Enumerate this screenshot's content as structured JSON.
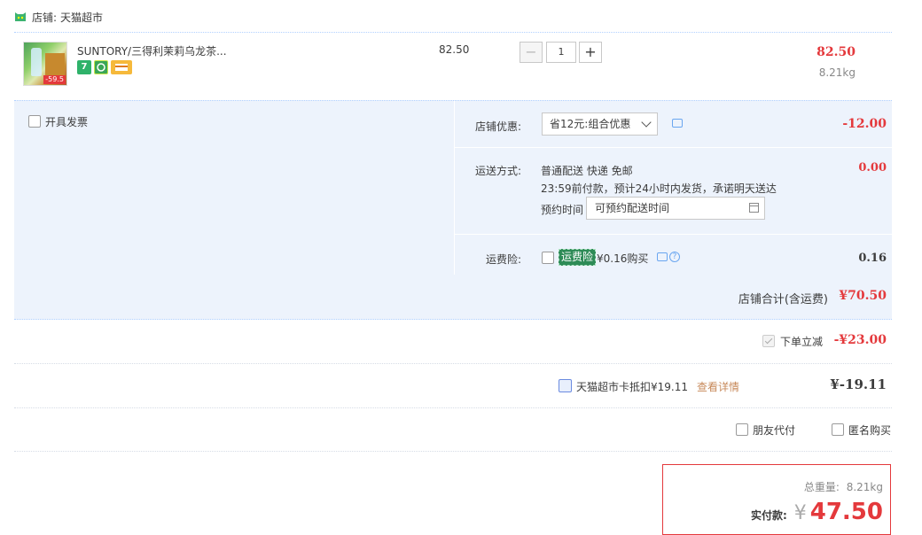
{
  "shop": {
    "label": "店铺:",
    "name": "天猫超市"
  },
  "item": {
    "title": "SUNTORY/三得利茉莉乌龙茶...",
    "image_price_tag": "-59.5",
    "badge_1": "7",
    "unit_price": "82.50",
    "quantity": "1",
    "minus_label": "−",
    "plus_label": "+",
    "total": "82.50",
    "weight": "8.21kg"
  },
  "invoice": {
    "label": "开具发票"
  },
  "shop_discount": {
    "label": "店铺优惠:",
    "selected": "省12元:组合优惠",
    "amount": "-12.00"
  },
  "shipping": {
    "label": "运送方式:",
    "line1": "普通配送 快递 免邮",
    "line2": "23:59前付款，预计24小时内发货，承诺明天送达",
    "schedule_label": "预约时间",
    "schedule_value": "可预约配送时间",
    "amount": "0.00"
  },
  "insurance": {
    "label": "运费险:",
    "tag": "运费险",
    "price": "¥0.16购买",
    "amount": "0.16"
  },
  "shop_total": {
    "label": "店铺合计(含运费)",
    "amount": "¥70.50"
  },
  "instant_discount": {
    "label": "下单立减",
    "amount": "-¥23.00"
  },
  "card_deduct": {
    "label": "天猫超市卡抵扣¥19.11",
    "detail": "查看详情",
    "amount": "¥-19.11"
  },
  "pay_options": {
    "friend": "朋友代付",
    "anonymous": "匿名购买"
  },
  "summary": {
    "weight_label": "总重量:",
    "weight": "8.21kg",
    "pay_label": "实付款:",
    "currency": "¥",
    "amount": "47.50"
  },
  "colors": {
    "accent": "#e4393c",
    "panel": "#edf3fc",
    "link": "#c7895a"
  }
}
